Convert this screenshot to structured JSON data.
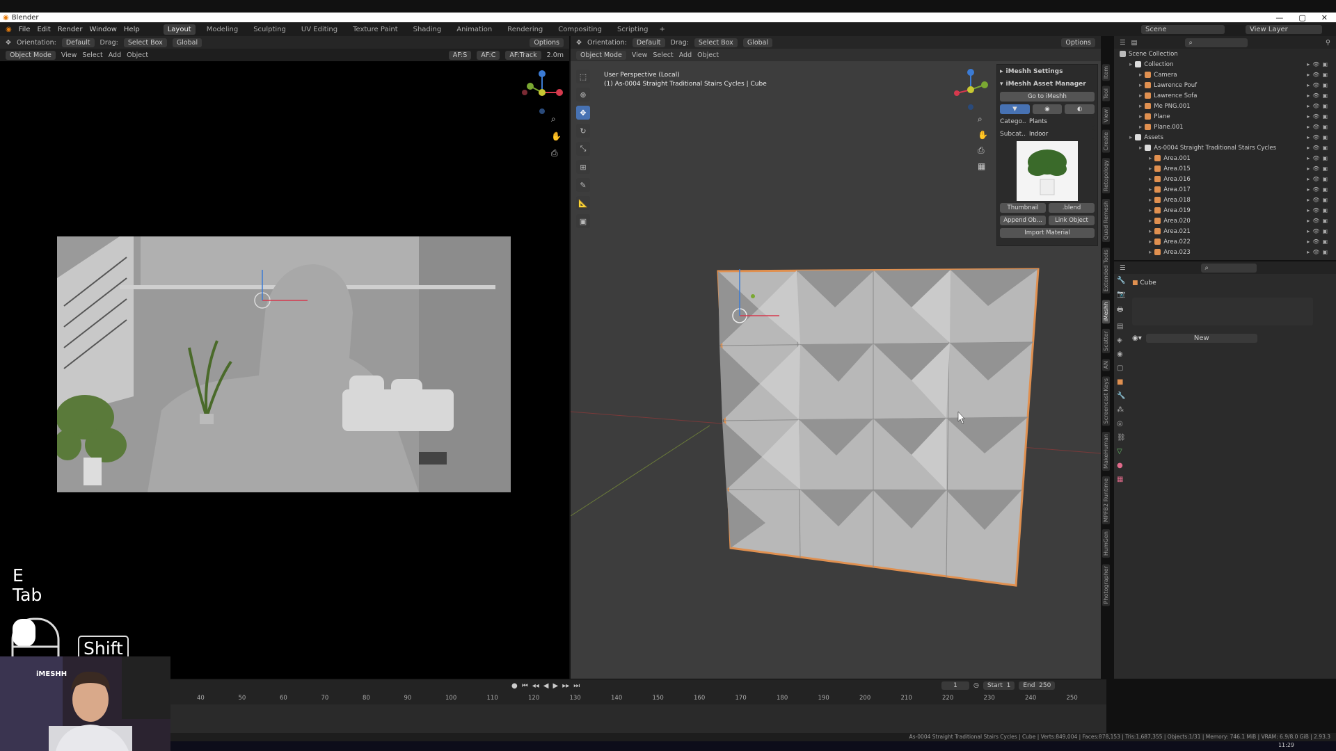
{
  "window": {
    "title": "Blender"
  },
  "menu": [
    "File",
    "Edit",
    "Render",
    "Window",
    "Help"
  ],
  "workspaces": [
    {
      "label": "Layout",
      "active": true
    },
    {
      "label": "Modeling"
    },
    {
      "label": "Sculpting"
    },
    {
      "label": "UV Editing"
    },
    {
      "label": "Texture Paint"
    },
    {
      "label": "Shading"
    },
    {
      "label": "Animation"
    },
    {
      "label": "Rendering"
    },
    {
      "label": "Compositing"
    },
    {
      "label": "Scripting"
    }
  ],
  "topright": {
    "scene": "Scene",
    "view_layer": "View Layer"
  },
  "left_header": {
    "orientation_label": "Orientation:",
    "orientation_value": "Default",
    "drag_label": "Drag:",
    "drag_value": "Select Box",
    "transform": "Global",
    "options": "Options",
    "mode": "Object Mode",
    "view": "View",
    "select": "Select",
    "add": "Add",
    "object": "Object",
    "af_s": "AF:S",
    "af_c": "AF:C",
    "af_track": "AF:Track",
    "distance": "2.0m"
  },
  "right_header": {
    "orientation_label": "Orientation:",
    "orientation_value": "Default",
    "drag_label": "Drag:",
    "drag_value": "Select Box",
    "transform": "Global",
    "options": "Options",
    "mode": "Object Mode",
    "view": "View",
    "select": "Select",
    "add": "Add",
    "object": "Object"
  },
  "viewport_info": {
    "line1": "User Perspective (Local)",
    "line2": "(1) As-0004 Straight Traditional Stairs Cycles | Cube"
  },
  "npanel": {
    "settings": "iMeshh Settings",
    "manager": "iMeshh Asset Manager",
    "goto": "Go to iMeshh",
    "category_label": "Catego...",
    "category_value": "Plants",
    "subcat_label": "Subcat...",
    "subcat_value": "Indoor",
    "thumbnail": "Thumbnail",
    "blend": ".blend",
    "append": "Append Ob...",
    "link": "Link Object",
    "import_material": "Import Material"
  },
  "vertical_tabs": [
    "Item",
    "Tool",
    "View",
    "Create",
    "Retopology",
    "Quad Remesh",
    "Extended Tools",
    "iMeshh",
    "Scatter",
    "AN",
    "Screencast Keys",
    "MakeHuman",
    "MPFB2 Runtime",
    "HumGen",
    "Photographer"
  ],
  "outliner": {
    "root": "Scene Collection",
    "items": [
      {
        "label": "Collection",
        "indent": 1,
        "color": "#ddd"
      },
      {
        "label": "Camera",
        "indent": 2,
        "color": "#e09050"
      },
      {
        "label": "Lawrence Pouf",
        "indent": 2,
        "color": "#e09050"
      },
      {
        "label": "Lawrence Sofa",
        "indent": 2,
        "color": "#e09050"
      },
      {
        "label": "Me PNG.001",
        "indent": 2,
        "color": "#e09050"
      },
      {
        "label": "Plane",
        "indent": 2,
        "color": "#e09050"
      },
      {
        "label": "Plane.001",
        "indent": 2,
        "color": "#e09050"
      },
      {
        "label": "Assets",
        "indent": 1,
        "color": "#ddd"
      },
      {
        "label": "As-0004 Straight Traditional Stairs Cycles",
        "indent": 2,
        "color": "#ddd"
      },
      {
        "label": "Area.001",
        "indent": 3,
        "color": "#e09050"
      },
      {
        "label": "Area.015",
        "indent": 3,
        "color": "#e09050"
      },
      {
        "label": "Area.016",
        "indent": 3,
        "color": "#e09050"
      },
      {
        "label": "Area.017",
        "indent": 3,
        "color": "#e09050"
      },
      {
        "label": "Area.018",
        "indent": 3,
        "color": "#e09050"
      },
      {
        "label": "Area.019",
        "indent": 3,
        "color": "#e09050"
      },
      {
        "label": "Area.020",
        "indent": 3,
        "color": "#e09050"
      },
      {
        "label": "Area.021",
        "indent": 3,
        "color": "#e09050"
      },
      {
        "label": "Area.022",
        "indent": 3,
        "color": "#e09050"
      },
      {
        "label": "Area.023",
        "indent": 3,
        "color": "#e09050"
      }
    ]
  },
  "properties": {
    "object": "Cube",
    "new": "New"
  },
  "keys": {
    "k1": "E",
    "k2": "Tab",
    "shift": "Shift"
  },
  "timeline": {
    "frame": "1",
    "start_label": "Start",
    "start": "1",
    "end_label": "End",
    "end": "250",
    "ticks": [
      "40",
      "50",
      "60",
      "70",
      "80",
      "90",
      "100",
      "110",
      "120",
      "130",
      "140",
      "150",
      "160",
      "170",
      "180",
      "190",
      "200",
      "210",
      "220",
      "230",
      "240",
      "250"
    ]
  },
  "status": "As-0004 Straight Traditional Stairs Cycles | Cube | Verts:849,004 | Faces:878,153 | Tris:1,687,355 | Objects:1/31 | Memory: 746.1 MiB | VRAM: 6.9/8.0 GiB | 2.93.3",
  "clock": "11:29",
  "webcam_logo": "iMESHH"
}
